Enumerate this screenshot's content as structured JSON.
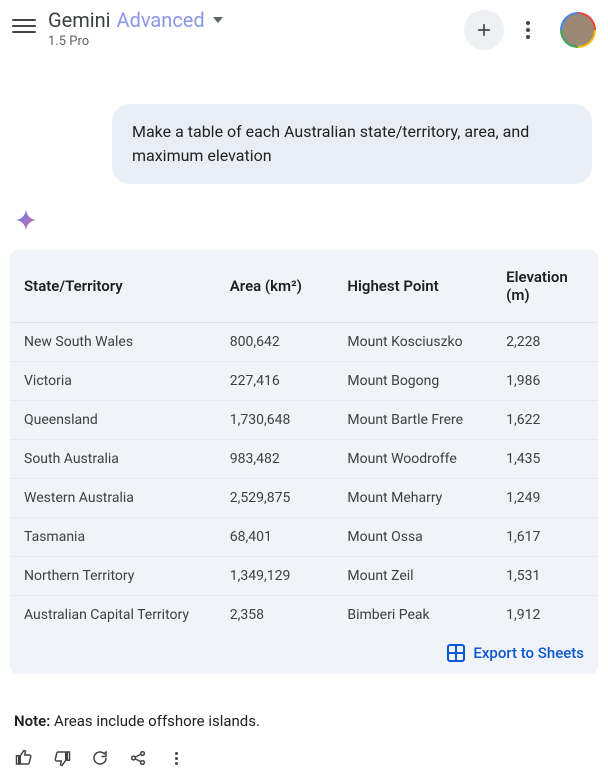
{
  "header": {
    "title_main": "Gemini",
    "title_accent": "Advanced",
    "subtitle": "1.5 Pro"
  },
  "prompt": "Make a table of each Australian state/territory, area, and maximum elevation",
  "table": {
    "headers": [
      "State/Territory",
      "Area (km²)",
      "Highest Point",
      "Elevation (m)"
    ],
    "rows": [
      [
        "New South Wales",
        "800,642",
        "Mount Kosciuszko",
        "2,228"
      ],
      [
        "Victoria",
        "227,416",
        "Mount Bogong",
        "1,986"
      ],
      [
        "Queensland",
        "1,730,648",
        "Mount Bartle Frere",
        "1,622"
      ],
      [
        "South Australia",
        "983,482",
        "Mount Woodroffe",
        "1,435"
      ],
      [
        "Western Australia",
        "2,529,875",
        "Mount Meharry",
        "1,249"
      ],
      [
        "Tasmania",
        "68,401",
        "Mount Ossa",
        "1,617"
      ],
      [
        "Northern Territory",
        "1,349,129",
        "Mount Zeil",
        "1,531"
      ],
      [
        "Australian Capital Territory",
        "2,358",
        "Bimberi Peak",
        "1,912"
      ]
    ],
    "export_label": "Export to Sheets"
  },
  "note_label": "Note:",
  "note_text": " Areas include offshore islands."
}
